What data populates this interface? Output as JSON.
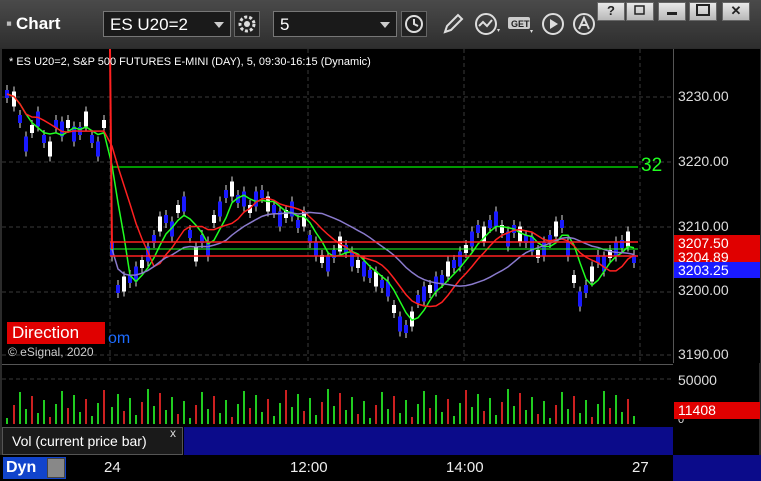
{
  "window": {
    "title": "Chart",
    "symbol": "ES U20=2",
    "interval": "5",
    "buttons": {
      "help": "?",
      "restore": "",
      "minimize": "",
      "maximize": "",
      "close": "✕"
    }
  },
  "chart": {
    "label": "* ES U20=2, S&P 500 FUTURES E-MINI (DAY), 5, 09:30-16:15 (Dynamic)",
    "copyright": "© eSignal, 2020",
    "direction_label": "Direction",
    "direction_suffix": "om",
    "horizontal_line_label": "32",
    "colors": {
      "up": "#1a1aff",
      "down": "#ffffff",
      "ema_red": "#ff2020",
      "ema_green": "#20ff20",
      "ma_purple": "#8a7acc",
      "hline": "#00cc00"
    }
  },
  "price_axis": {
    "ticks": [
      "3230.00",
      "3220.00",
      "3210.00",
      "3200.00",
      "3190.00"
    ],
    "tags": [
      {
        "text": "3207.50",
        "color": "#e00000"
      },
      {
        "text": "3204.89",
        "color": "#e00000"
      },
      {
        "text": "3203.25",
        "color": "#1a1aff"
      }
    ]
  },
  "volume": {
    "label": "Vol (current price bar)",
    "close_icon": "x",
    "ticks": [
      "50000",
      "0"
    ],
    "current": "11408"
  },
  "time_axis": {
    "labels": [
      "24",
      "12:00",
      "14:00",
      "27"
    ]
  },
  "status": {
    "mode": "Dyn"
  }
}
